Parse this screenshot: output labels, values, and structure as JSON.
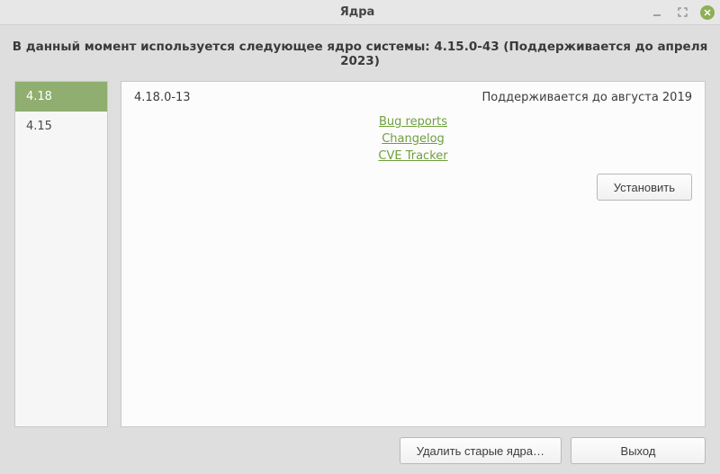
{
  "window": {
    "title": "Ядра"
  },
  "header": {
    "message": "В данный момент используется следующее ядро системы: 4.15.0-43 (Поддерживается до апреля 2023)"
  },
  "sidebar": {
    "items": [
      {
        "label": "4.18",
        "active": true
      },
      {
        "label": "4.15",
        "active": false
      }
    ]
  },
  "kernel": {
    "version": "4.18.0-13",
    "support": "Поддерживается до августа 2019",
    "links": {
      "bug_reports": "Bug reports",
      "changelog": "Changelog",
      "cve_tracker": "CVE Tracker"
    },
    "install_label": "Установить"
  },
  "footer": {
    "remove_old": "Удалить старые ядра…",
    "exit": "Выход"
  }
}
